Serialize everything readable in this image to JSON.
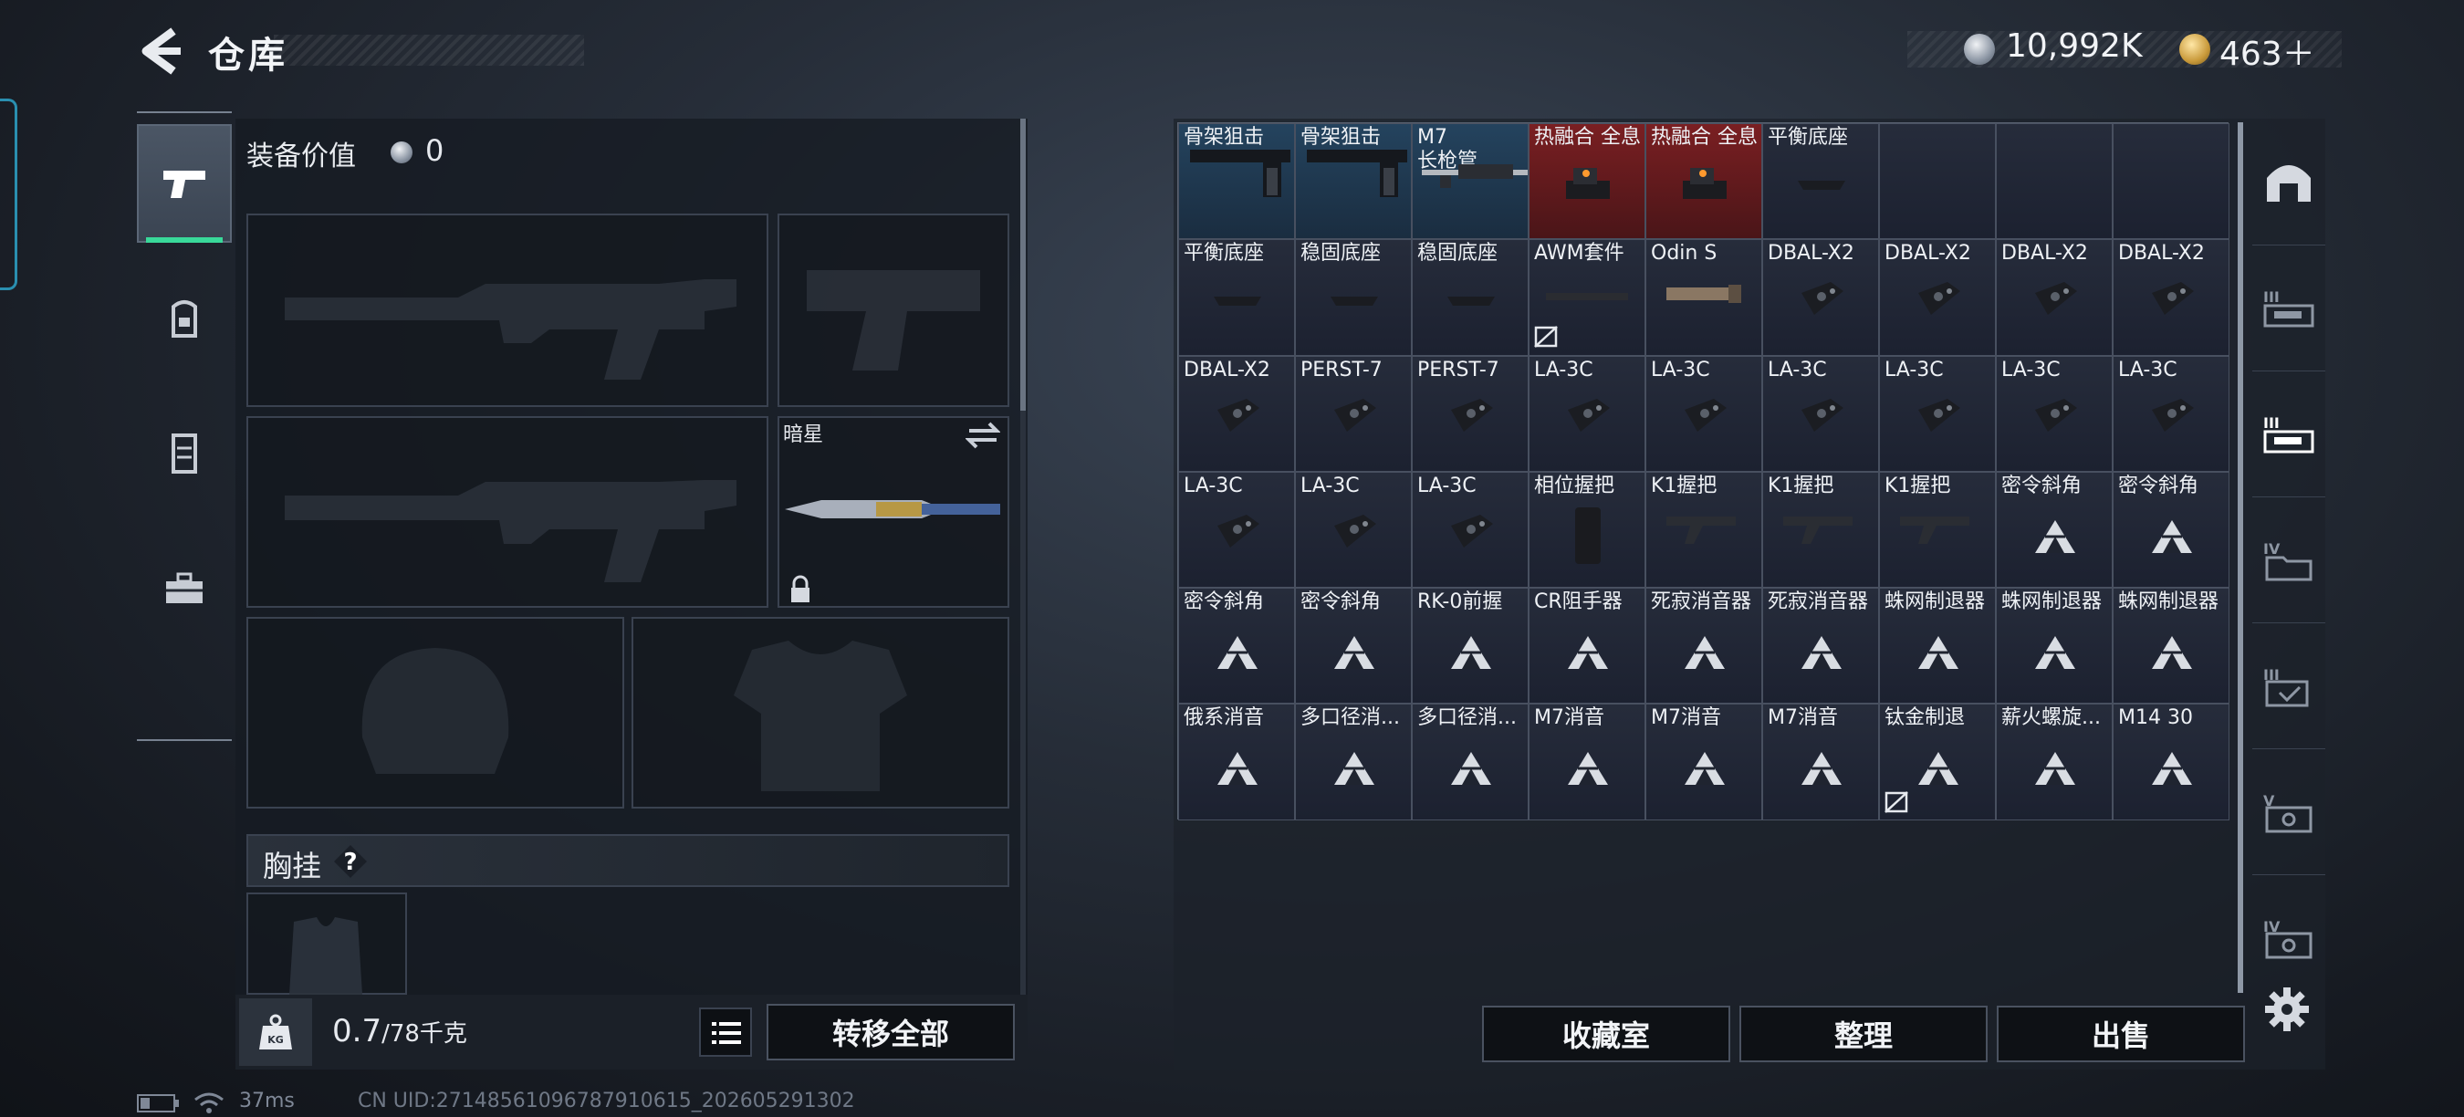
{
  "header": {
    "title": "仓库",
    "coins": "10,992K",
    "coupons": "463＋"
  },
  "loadout": {
    "equip_value_label": "装备价值",
    "equip_value": "0",
    "melee_name": "暗星",
    "chest_rig_label": "胸挂",
    "weight_value": "0.7",
    "weight_unit": "/78千克",
    "transfer_all": "转移全部"
  },
  "warehouse": {
    "cells": [
      {
        "label": "骨架狙击",
        "style": "blue",
        "icon": "stock-icon"
      },
      {
        "label": "骨架狙击",
        "style": "blue",
        "icon": "stock-icon"
      },
      {
        "label": "M7\n长枪管",
        "style": "blue",
        "icon": "barrel-icon"
      },
      {
        "label": "热融合 全息",
        "style": "red",
        "icon": "sight-icon"
      },
      {
        "label": "热融合 全息",
        "style": "red",
        "icon": "sight-icon"
      },
      {
        "label": "平衡底座",
        "style": "",
        "icon": "mount-icon"
      },
      {
        "label": "",
        "style": "",
        "icon": ""
      },
      {
        "label": "",
        "style": "",
        "icon": ""
      },
      {
        "label": "",
        "style": "",
        "icon": ""
      },
      {
        "label": "平衡底座",
        "style": "",
        "icon": "mount-icon"
      },
      {
        "label": "稳固底座",
        "style": "",
        "icon": "mount-icon"
      },
      {
        "label": "稳固底座",
        "style": "",
        "icon": "mount-icon"
      },
      {
        "label": "AWM套件",
        "style": "",
        "icon": "rail-icon"
      },
      {
        "label": "Odin S",
        "style": "",
        "icon": "flashlight-icon"
      },
      {
        "label": "DBAL-X2",
        "style": "",
        "icon": "laser-icon"
      },
      {
        "label": "DBAL-X2",
        "style": "",
        "icon": "laser-icon"
      },
      {
        "label": "DBAL-X2",
        "style": "",
        "icon": "laser-icon"
      },
      {
        "label": "DBAL-X2",
        "style": "",
        "icon": "laser-icon"
      },
      {
        "label": "DBAL-X2",
        "style": "",
        "icon": "laser-icon"
      },
      {
        "label": "PERST-7",
        "style": "",
        "icon": "laser-icon"
      },
      {
        "label": "PERST-7",
        "style": "",
        "icon": "laser-icon"
      },
      {
        "label": "LA-3C",
        "style": "",
        "icon": "laser-icon"
      },
      {
        "label": "LA-3C",
        "style": "",
        "icon": "laser-icon"
      },
      {
        "label": "LA-3C",
        "style": "",
        "icon": "laser-icon"
      },
      {
        "label": "LA-3C",
        "style": "",
        "icon": "laser-icon"
      },
      {
        "label": "LA-3C",
        "style": "",
        "icon": "laser-icon"
      },
      {
        "label": "LA-3C",
        "style": "",
        "icon": "laser-icon"
      },
      {
        "label": "LA-3C",
        "style": "",
        "icon": "laser-icon"
      },
      {
        "label": "LA-3C",
        "style": "",
        "icon": "laser-icon"
      },
      {
        "label": "LA-3C",
        "style": "",
        "icon": "laser-icon"
      },
      {
        "label": "相位握把",
        "style": "",
        "icon": "grip-icon"
      },
      {
        "label": "K1握把",
        "style": "",
        "icon": "stock-small-icon"
      },
      {
        "label": "K1握把",
        "style": "",
        "icon": "stock-small-icon"
      },
      {
        "label": "K1握把",
        "style": "",
        "icon": "stock-small-icon"
      },
      {
        "label": "密令斜角",
        "style": "",
        "icon": "placeholder-icon"
      },
      {
        "label": "密令斜角",
        "style": "",
        "icon": "placeholder-icon"
      },
      {
        "label": "密令斜角",
        "style": "",
        "icon": "placeholder-icon"
      },
      {
        "label": "密令斜角",
        "style": "",
        "icon": "placeholder-icon"
      },
      {
        "label": "RK-0前握",
        "style": "",
        "icon": "placeholder-icon"
      },
      {
        "label": "CR阻手器",
        "style": "",
        "icon": "placeholder-icon"
      },
      {
        "label": "死寂消音器",
        "style": "",
        "icon": "placeholder-icon"
      },
      {
        "label": "死寂消音器",
        "style": "",
        "icon": "placeholder-icon"
      },
      {
        "label": "蛛网制退器",
        "style": "",
        "icon": "placeholder-icon"
      },
      {
        "label": "蛛网制退器",
        "style": "",
        "icon": "placeholder-icon"
      },
      {
        "label": "蛛网制退器",
        "style": "",
        "icon": "placeholder-icon"
      },
      {
        "label": "俄系消音",
        "style": "",
        "icon": "placeholder-icon"
      },
      {
        "label": "多口径消...",
        "style": "",
        "icon": "placeholder-icon"
      },
      {
        "label": "多口径消...",
        "style": "",
        "icon": "placeholder-icon"
      },
      {
        "label": "M7消音",
        "style": "",
        "icon": "placeholder-icon"
      },
      {
        "label": "M7消音",
        "style": "",
        "icon": "placeholder-icon"
      },
      {
        "label": "M7消音",
        "style": "",
        "icon": "placeholder-icon"
      },
      {
        "label": "钛金制退",
        "style": "",
        "icon": "placeholder-icon"
      },
      {
        "label": "薪火螺旋...",
        "style": "",
        "icon": "placeholder-icon"
      },
      {
        "label": "M14 30",
        "style": "",
        "icon": "placeholder-icon"
      }
    ],
    "buttons": {
      "collection": "收藏室",
      "organize": "整理",
      "sell": "出售"
    }
  },
  "footer": {
    "ping": "37ms",
    "uid": "CN UID:2714856109678791061​5_202605291302"
  }
}
